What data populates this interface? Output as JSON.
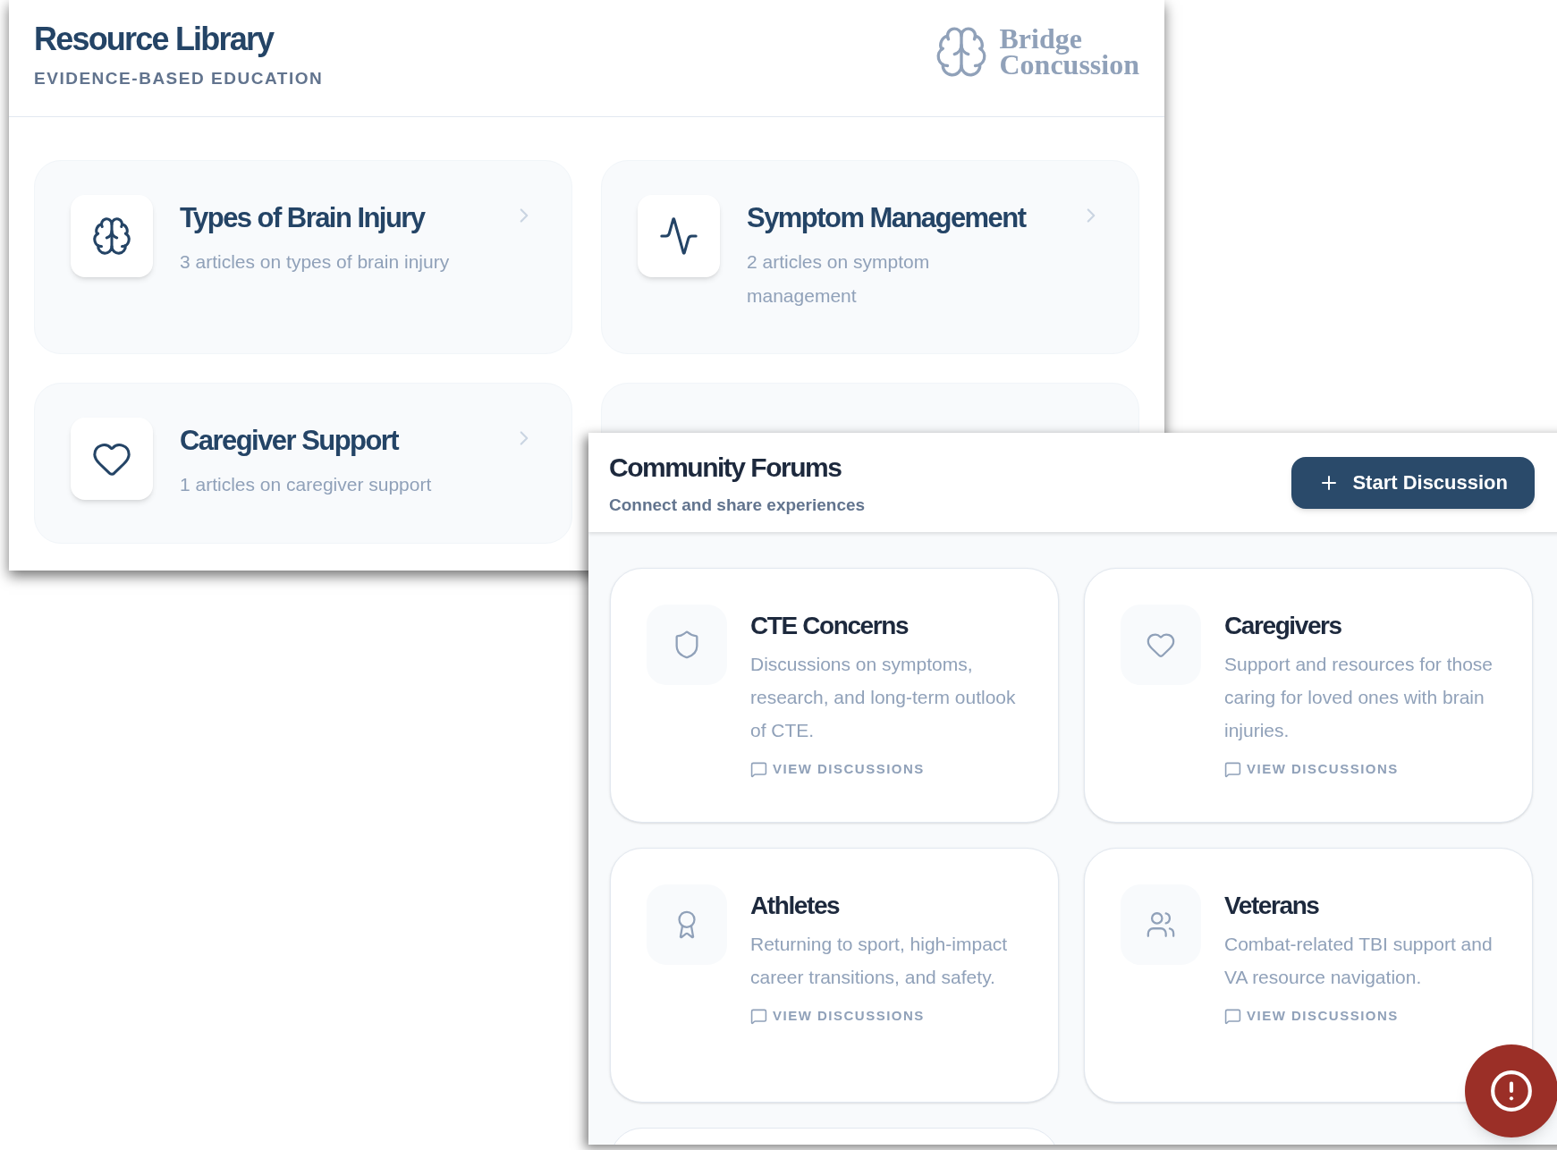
{
  "library": {
    "title": "Resource Library",
    "subtitle": "EVIDENCE-BASED EDUCATION",
    "logo": {
      "line1": "Bridge",
      "line2": "Concussion"
    },
    "categories": [
      {
        "kind": "brain",
        "title": "Types of Brain Injury",
        "description": "3 articles on types of brain injury"
      },
      {
        "kind": "pulse",
        "title": "Symptom Management",
        "description": "2 articles on symptom management"
      },
      {
        "kind": "heart",
        "title": "Caregiver Support",
        "description": "1 articles on caregiver support"
      }
    ]
  },
  "forums": {
    "title": "Community Forums",
    "subtitle": "Connect and share experiences",
    "action": "Start Discussion",
    "items": [
      {
        "kind": "shield",
        "title": "CTE Concerns",
        "description": "Discussions on symptoms, research, and long-term outlook of CTE.",
        "link": "VIEW DISCUSSIONS"
      },
      {
        "kind": "heart",
        "title": "Caregivers",
        "description": "Support and resources for those caring for loved ones with brain injuries.",
        "link": "VIEW DISCUSSIONS"
      },
      {
        "kind": "award",
        "title": "Athletes",
        "description": "Returning to sport, high-impact career transitions, and safety.",
        "link": "VIEW DISCUSSIONS"
      },
      {
        "kind": "users",
        "title": "Veterans",
        "description": "Combat-related TBI support and VA resource navigation.",
        "link": "VIEW DISCUSSIONS"
      }
    ]
  }
}
